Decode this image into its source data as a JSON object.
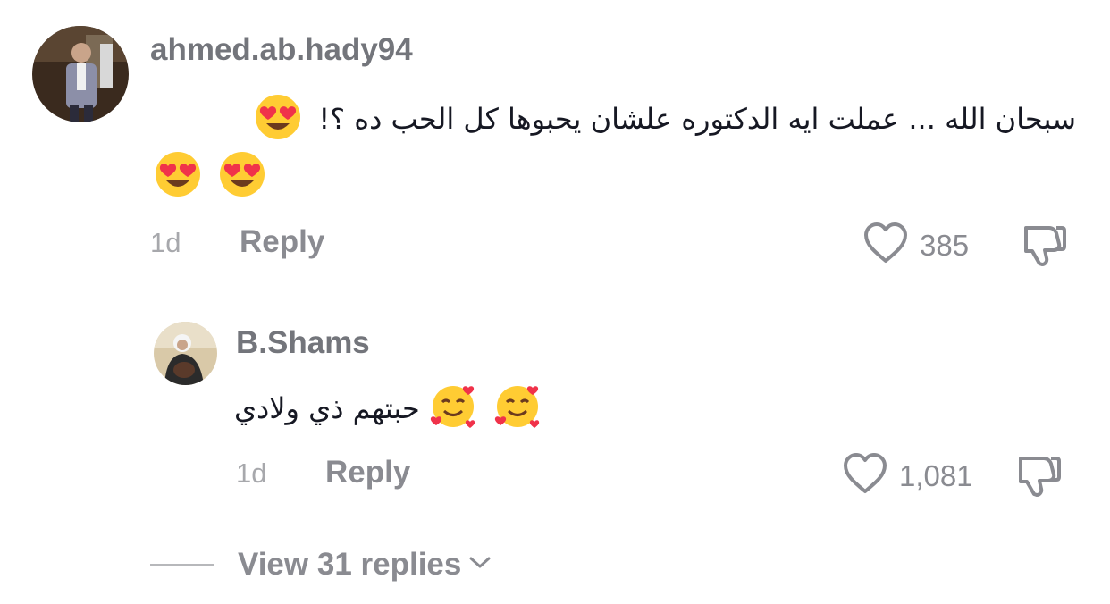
{
  "comments": [
    {
      "username": "ahmed.ab.hady94",
      "text": "سبحان الله ... عملت ايه الدكتوره علشان يحبوها كل الحب ده ؟!",
      "emoji": "smiling-face-with-heart-eyes",
      "time": "1d",
      "reply_label": "Reply",
      "likes": "385"
    }
  ],
  "replies": [
    {
      "username": "B.Shams",
      "text": "حبتهم ذي ولادي",
      "emoji": "smiling-face-with-hearts",
      "time": "1d",
      "reply_label": "Reply",
      "likes": "1,081"
    }
  ],
  "view_replies_label": "View 31 replies",
  "colors": {
    "text": "#161823",
    "muted": "#8a8b91",
    "light": "#a7a8ac"
  }
}
